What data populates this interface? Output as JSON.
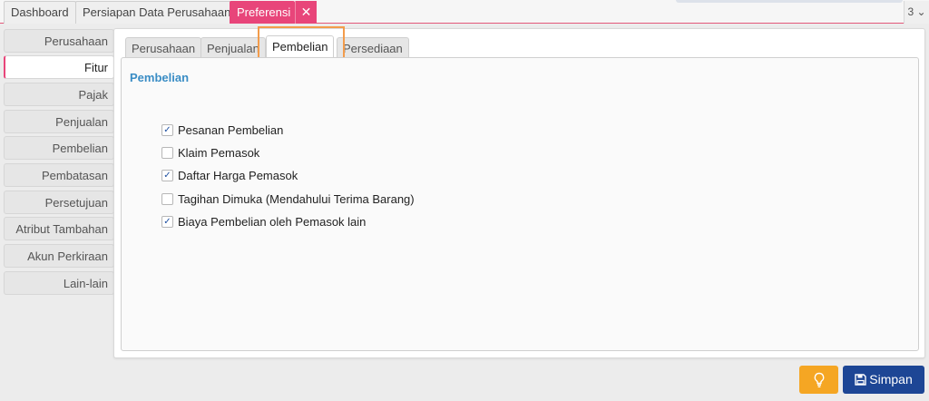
{
  "top_tabs": [
    {
      "label": "Dashboard"
    },
    {
      "label": "Persiapan Data Perusahaan"
    },
    {
      "label": "Preferensi"
    }
  ],
  "tab_close_symbol": "✕",
  "tab_counter": "3 ⌄",
  "sidebar": {
    "items": [
      {
        "label": "Perusahaan"
      },
      {
        "label": "Fitur"
      },
      {
        "label": "Pajak"
      },
      {
        "label": "Penjualan"
      },
      {
        "label": "Pembelian"
      },
      {
        "label": "Pembatasan"
      },
      {
        "label": "Persetujuan"
      },
      {
        "label": "Atribut Tambahan"
      },
      {
        "label": "Akun Perkiraan"
      },
      {
        "label": "Lain-lain"
      }
    ],
    "active": "Fitur"
  },
  "sub_tabs": [
    {
      "label": "Perusahaan"
    },
    {
      "label": "Penjualan"
    },
    {
      "label": "Pembelian"
    },
    {
      "label": "Persediaan"
    }
  ],
  "sub_tab_active": "Pembelian",
  "section": {
    "title": "Pembelian",
    "options": [
      {
        "label": "Pesanan Pembelian",
        "checked": true
      },
      {
        "label": "Klaim Pemasok",
        "checked": false
      },
      {
        "label": "Daftar Harga Pemasok",
        "checked": true
      },
      {
        "label": "Tagihan Dimuka (Mendahului Terima Barang)",
        "checked": false
      },
      {
        "label": "Biaya Pembelian oleh Pemasok lain",
        "checked": true
      }
    ]
  },
  "buttons": {
    "save_label": "Simpan"
  },
  "colors": {
    "accent_pink": "#e8457a",
    "save_blue": "#1d4695",
    "idea_orange": "#f5a623",
    "section_title_blue": "#3a8dc5",
    "highlight_orange": "#f39c4b"
  },
  "icons": {
    "close": "close-icon",
    "chevron": "chevron-down-icon",
    "idea": "lightbulb-icon",
    "save": "floppy-disk-icon"
  }
}
